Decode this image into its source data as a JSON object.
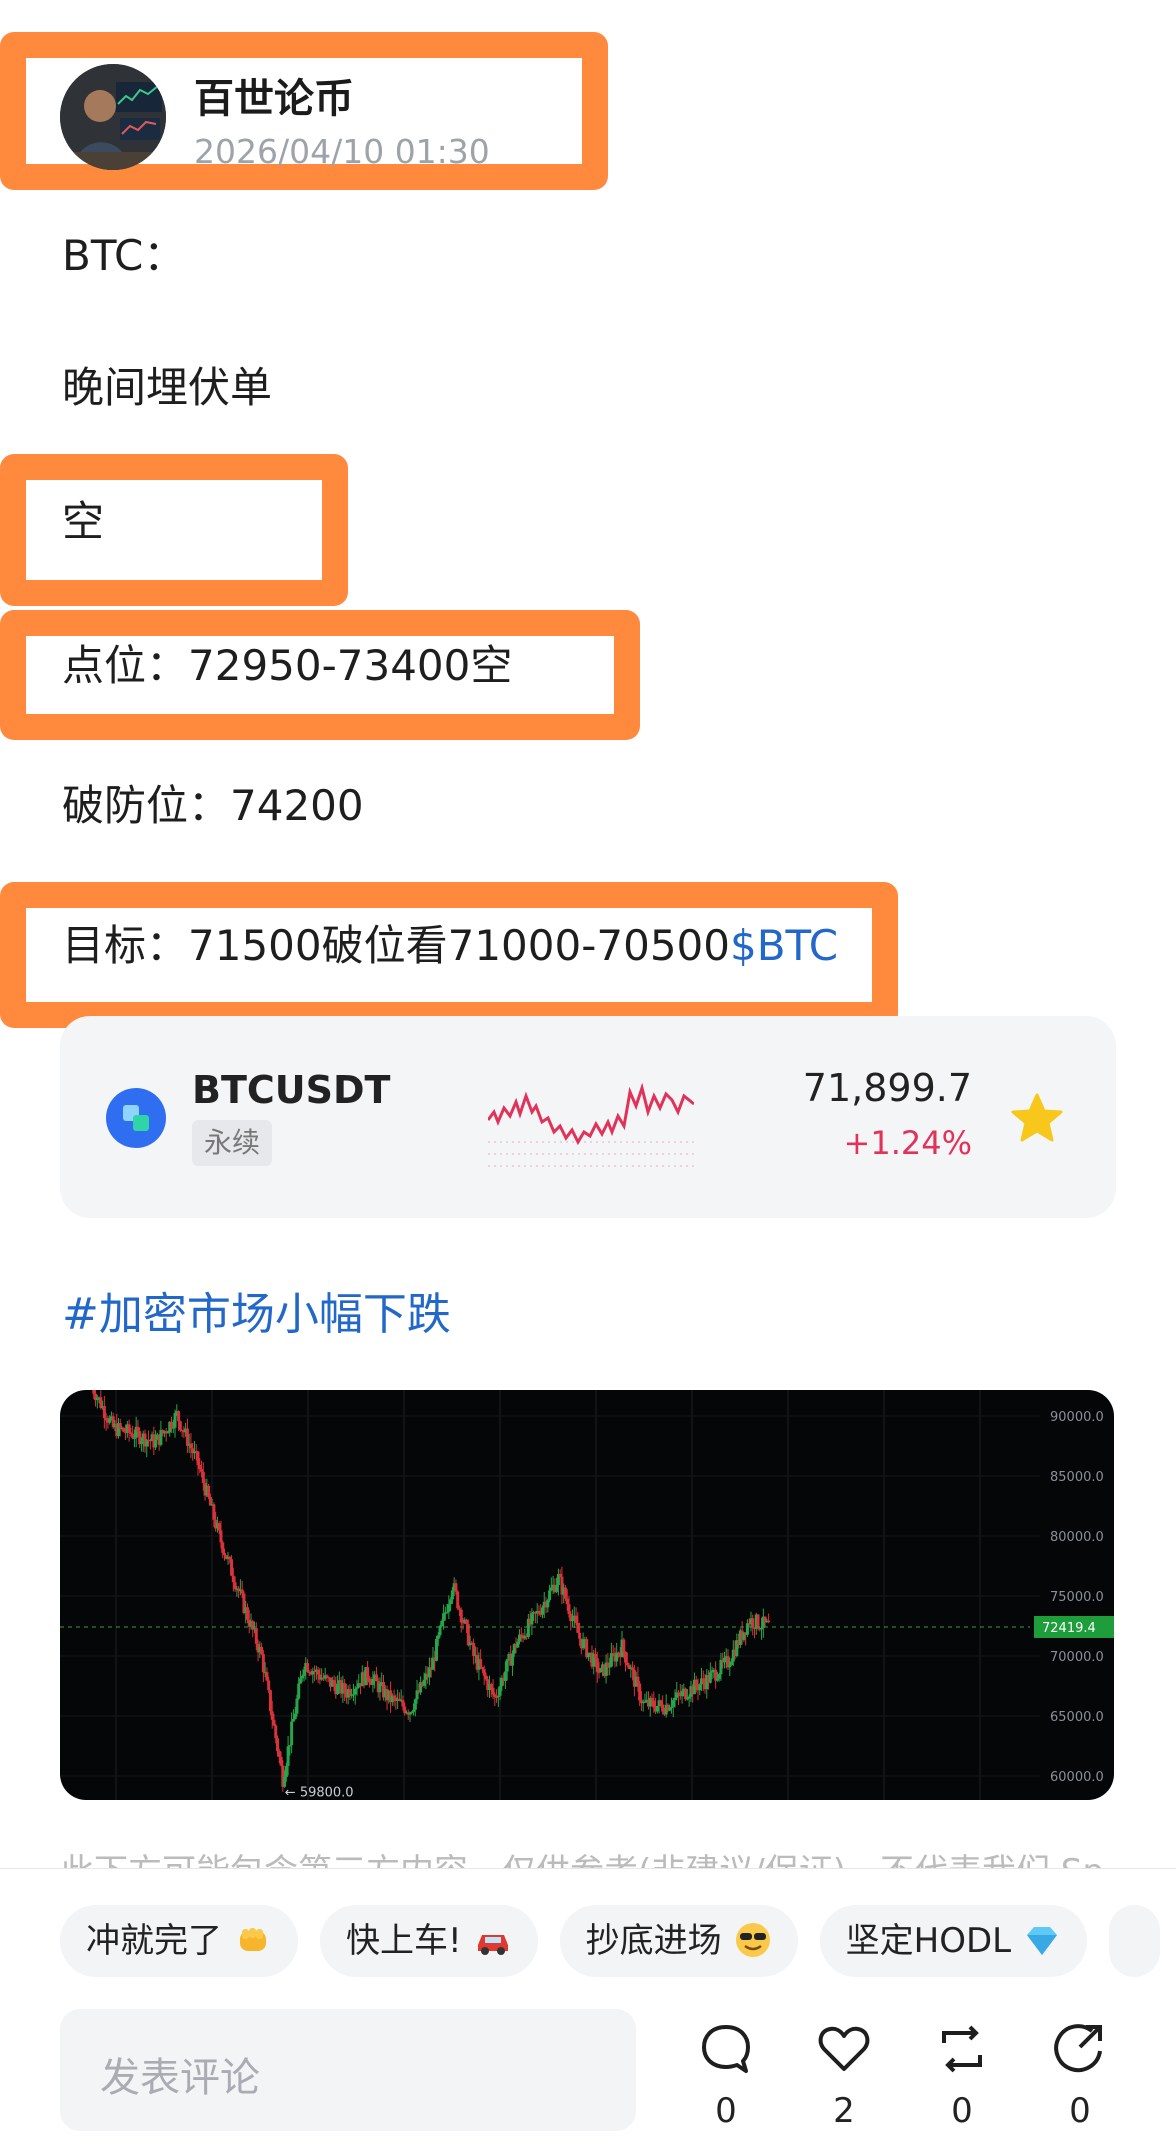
{
  "post": {
    "author_name": "百世论币",
    "timestamp": "2026/04/10 01:30",
    "lines": {
      "l1": "BTC：",
      "l2": "晚间埋伏单",
      "l3": "空",
      "l4": "点位：72950-73400空",
      "l5": "破防位：74200",
      "l6_prefix": "目标：71500破位看71000-70500",
      "l6_tag": "$BTC"
    },
    "hashtag": "#加密市场小幅下跌"
  },
  "ticker": {
    "symbol": "BTCUSDT",
    "kind": "永续",
    "price": "71,899.7",
    "change": "+1.24%",
    "change_color": "#e1325a",
    "favorite_icon": "star-icon"
  },
  "chart_data": {
    "type": "line",
    "y_ticks": [
      "90000.0",
      "85000.0",
      "80000.0",
      "75000.0",
      "70000.0",
      "65000.0",
      "60000.0"
    ],
    "ylim": [
      60000,
      90000
    ],
    "current_price_label": "72419.4",
    "low_label": "← 59800.0",
    "x": [
      0,
      3,
      6,
      9,
      12,
      15,
      18,
      21,
      24,
      27,
      30,
      33,
      36,
      39,
      42,
      45,
      48,
      51,
      54,
      57,
      60,
      63,
      66,
      69,
      72,
      75,
      78,
      81,
      84,
      87,
      90,
      93,
      96
    ],
    "values": [
      92500,
      89000,
      88500,
      87800,
      90100,
      86000,
      80000,
      75000,
      70000,
      59800,
      69500,
      68000,
      67000,
      68500,
      66500,
      65500,
      69000,
      76000,
      70000,
      66500,
      71000,
      73500,
      76500,
      71500,
      68500,
      70800,
      66000,
      65800,
      67000,
      68000,
      69500,
      73000,
      72400
    ]
  },
  "bottom_bar": {
    "partial_text": "此下方可能包含第三方内容，仅供参考(非建议/保证)，不代表我们 Sp...认可其观",
    "chips": [
      {
        "label": "冲就完了",
        "icon": "fist-emoji-icon"
      },
      {
        "label": "快上车!",
        "icon": "car-emoji-icon"
      },
      {
        "label": "抄底进场",
        "icon": "cool-face-emoji-icon"
      },
      {
        "label": "坚定HODL",
        "icon": "diamond-emoji-icon"
      }
    ],
    "comment_placeholder": "发表评论",
    "actions": {
      "comment_count": "0",
      "like_count": "2",
      "repost_count": "0",
      "share_count": "0"
    }
  },
  "colors": {
    "highlight": "#ff8a3d",
    "link": "#2268c9",
    "down_red": "#e1325a",
    "chart_green_tag": "#1e9e3a"
  }
}
